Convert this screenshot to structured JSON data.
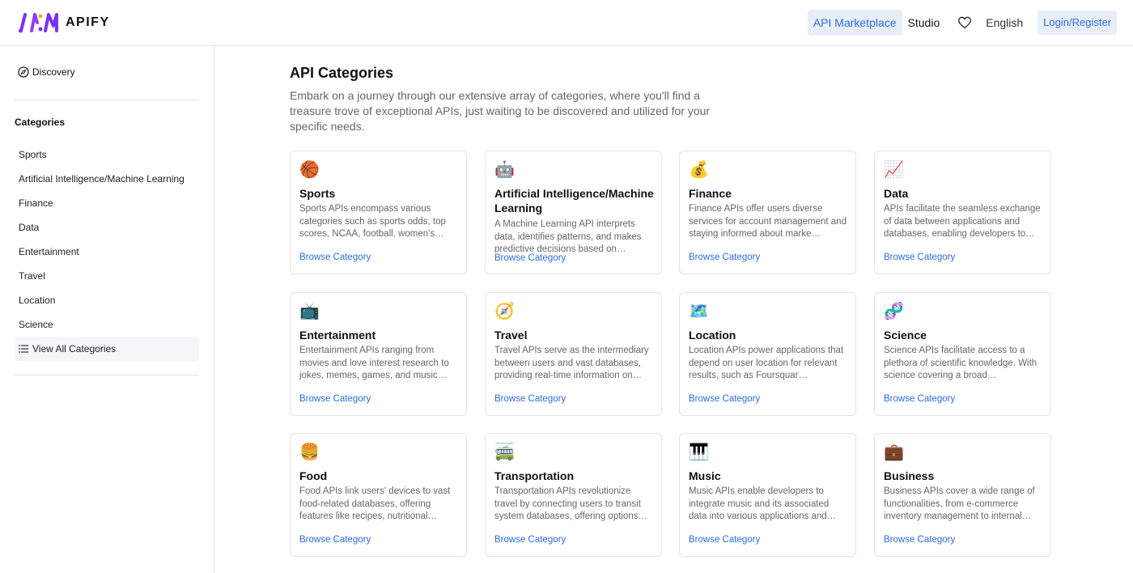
{
  "brand": {
    "name": "APIFY"
  },
  "nav": {
    "marketplace": "API Marketplace",
    "studio": "Studio",
    "language": "English",
    "login": "Login/Register"
  },
  "sidebar": {
    "discovery": "Discovery",
    "categories_title": "Categories",
    "items": [
      {
        "label": "Sports"
      },
      {
        "label": "Artificial Intelligence/Machine Learning"
      },
      {
        "label": "Finance"
      },
      {
        "label": "Data"
      },
      {
        "label": "Entertainment"
      },
      {
        "label": "Travel"
      },
      {
        "label": "Location"
      },
      {
        "label": "Science"
      }
    ],
    "view_all": "View All Categories"
  },
  "main": {
    "title": "API Categories",
    "description": "Embark on a journey through our extensive array of categories, where you'll find a treasure trove of exceptional APIs, just waiting to be discovered and utilized for your specific needs.",
    "cards": [
      {
        "icon": "🏀",
        "title": "Sports",
        "desc": "Sports APIs encompass various categories such as sports odds, top scores, NCAA, football, women's…",
        "link": "Browse Category"
      },
      {
        "icon": "🤖",
        "title": "Artificial Intelligence/Machine Learning",
        "desc": "A Machine Learning API interprets data, identifies patterns, and makes predictive decisions based on…",
        "link": "Browse Category"
      },
      {
        "icon": "💰",
        "title": "Finance",
        "desc": "Finance APIs offer users diverse services for account management and staying informed about marke…",
        "link": "Browse Category"
      },
      {
        "icon": "📈",
        "title": "Data",
        "desc": "APIs facilitate the seamless exchange of data between applications and databases, enabling developers to…",
        "link": "Browse Category"
      },
      {
        "icon": "📺",
        "title": "Entertainment",
        "desc": "Entertainment APIs ranging from movies and love interest research to jokes, memes, games, and music…",
        "link": "Browse Category"
      },
      {
        "icon": "🧭",
        "title": "Travel",
        "desc": "Travel APIs serve as the intermediary between users and vast databases, providing real-time information on…",
        "link": "Browse Category"
      },
      {
        "icon": "🗺️",
        "title": "Location",
        "desc": "Location APIs power applications that depend on user location for relevant results, such as Foursquar…",
        "link": "Browse Category"
      },
      {
        "icon": "🧬",
        "title": "Science",
        "desc": "Science APIs facilitate access to a plethora of scientific knowledge. With science covering a broad…",
        "link": "Browse Category"
      },
      {
        "icon": "🍔",
        "title": "Food",
        "desc": "Food APIs link users' devices to vast food-related databases, offering features like recipes, nutritional…",
        "link": "Browse Category"
      },
      {
        "icon": "🚎",
        "title": "Transportation",
        "desc": "Transportation APIs revolutionize travel by connecting users to transit system databases, offering options…",
        "link": "Browse Category"
      },
      {
        "icon": "🎹",
        "title": "Music",
        "desc": "Music APIs enable developers to integrate music and its associated data into various applications and…",
        "link": "Browse Category"
      },
      {
        "icon": "💼",
        "title": "Business",
        "desc": "Business APIs cover a wide range of functionalities, from e-commerce inventory management to internal…",
        "link": "Browse Category"
      }
    ]
  }
}
